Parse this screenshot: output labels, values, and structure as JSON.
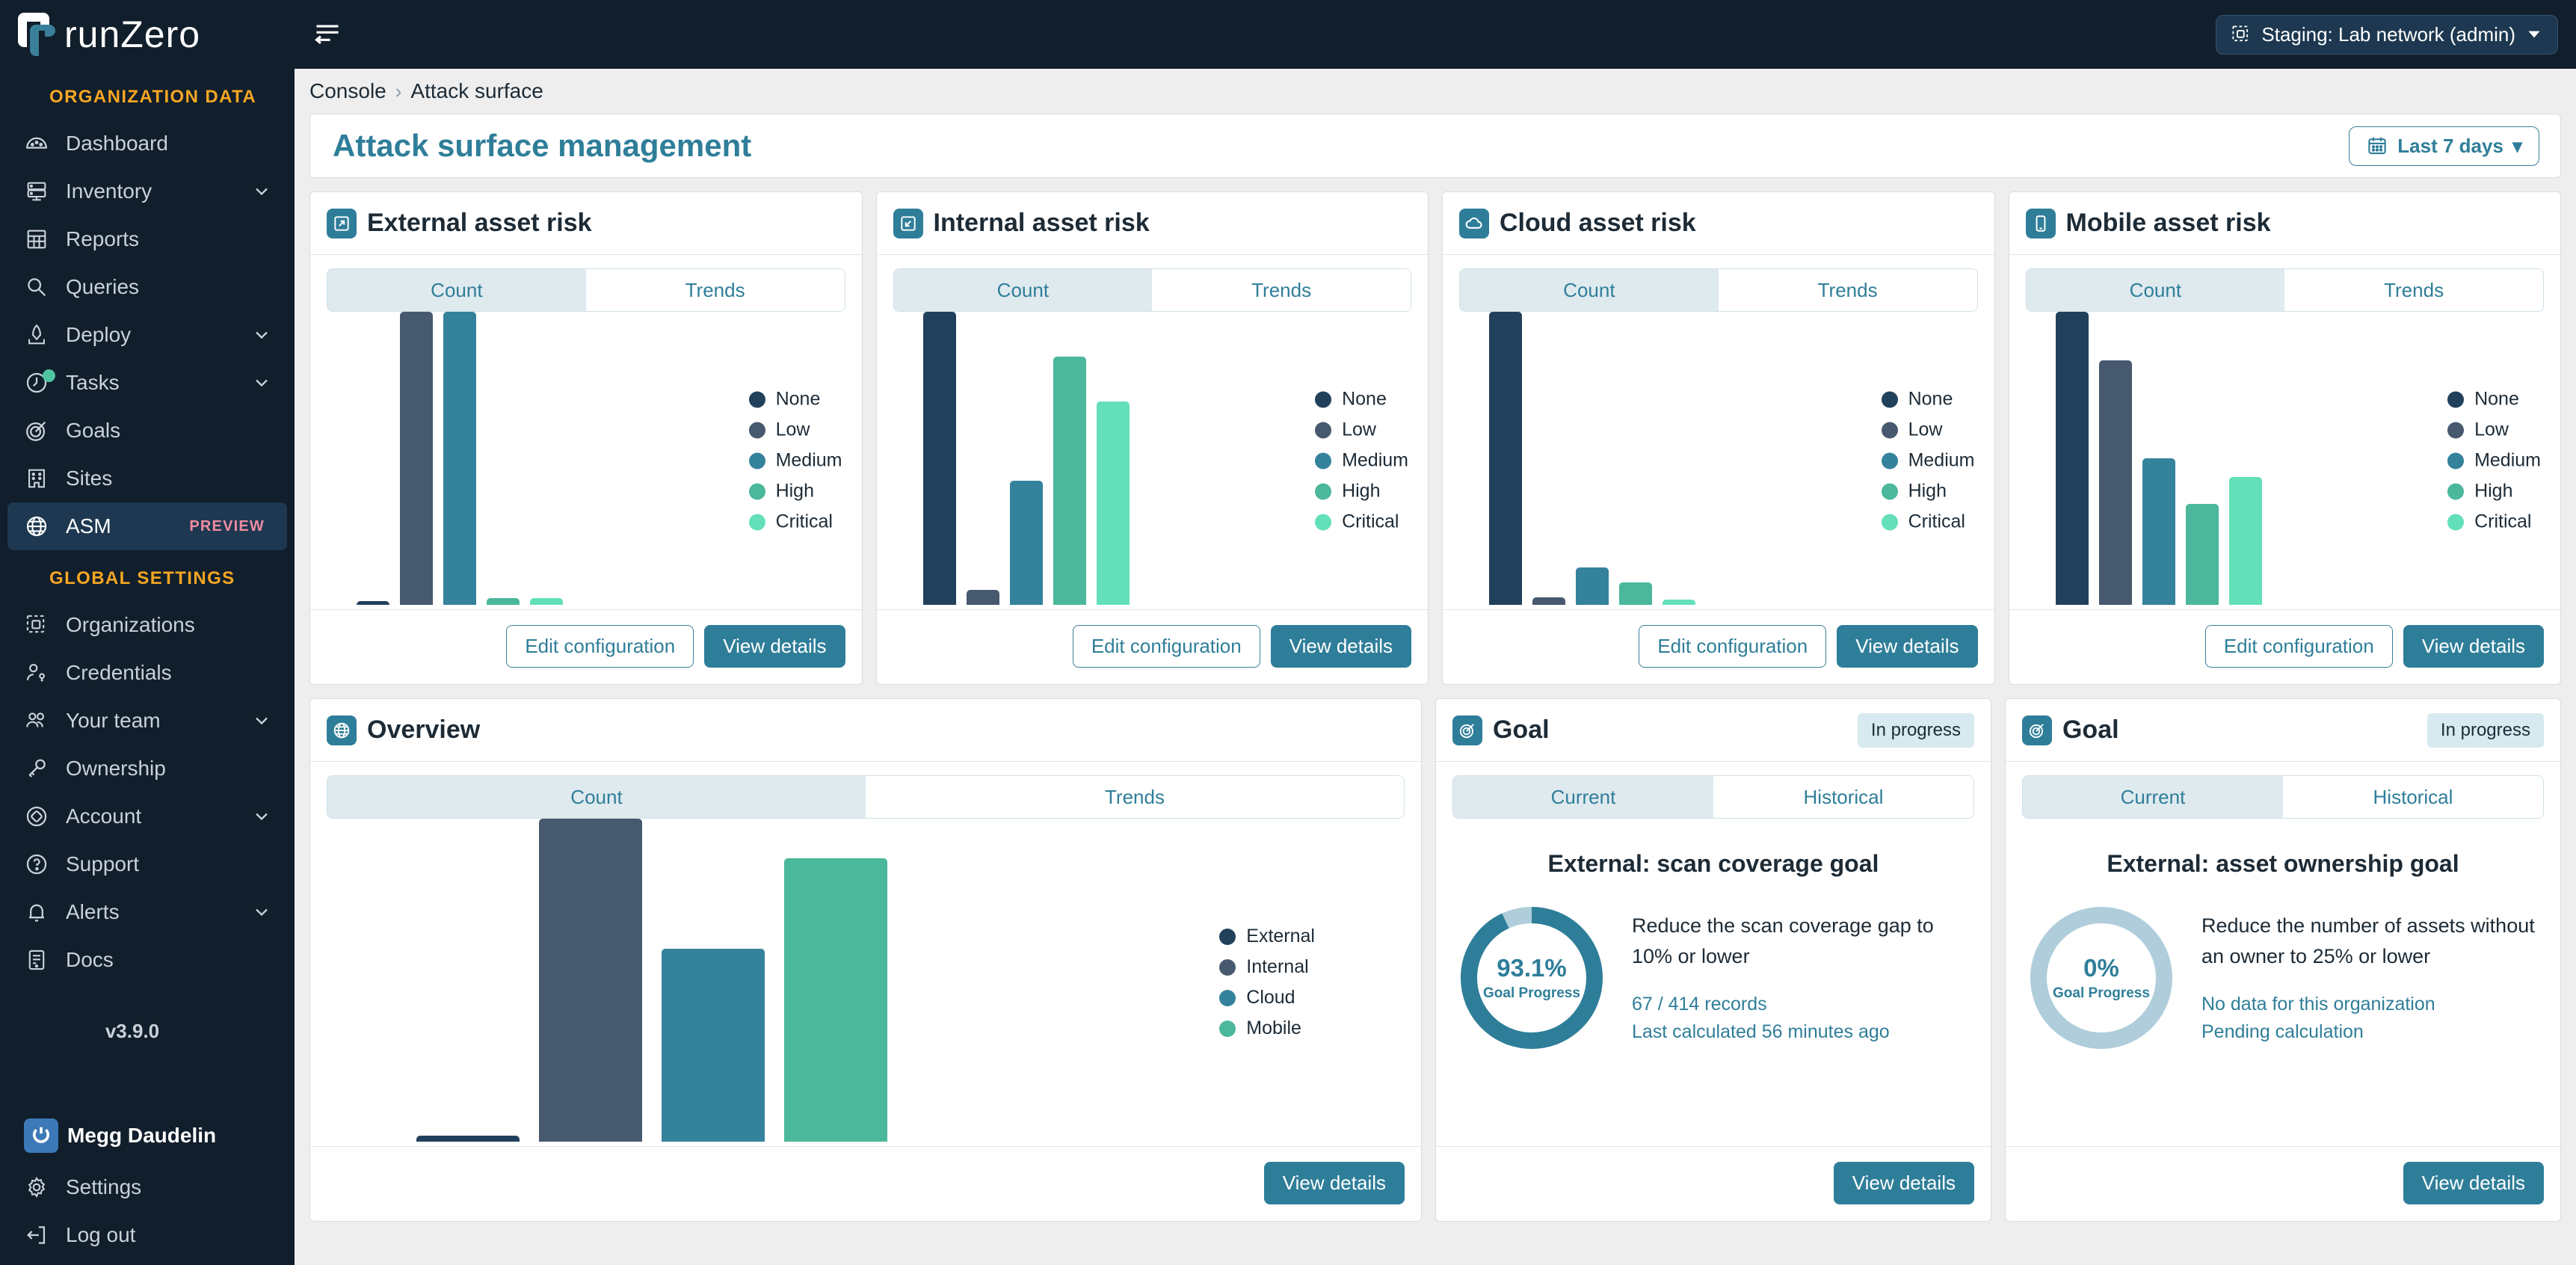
{
  "brand": {
    "name": "runZero",
    "accent": "#2f7e99",
    "sidebar_bg": "#111e2b",
    "section_color": "#f5a623"
  },
  "topbar": {
    "org_switcher": "Staging: Lab network (admin)",
    "menu_icon": "hamburger-icon"
  },
  "sidebar": {
    "section1_title": "ORGANIZATION DATA",
    "section2_title": "GLOBAL SETTINGS",
    "version": "v3.9.0",
    "user": "Megg Daudelin",
    "org_items": [
      {
        "label": "Dashboard",
        "icon": "gauge-icon",
        "expandable": false
      },
      {
        "label": "Inventory",
        "icon": "server-icon",
        "expandable": true
      },
      {
        "label": "Reports",
        "icon": "table-icon",
        "expandable": false
      },
      {
        "label": "Queries",
        "icon": "search-icon",
        "expandable": false
      },
      {
        "label": "Deploy",
        "icon": "rocket-icon",
        "expandable": true
      },
      {
        "label": "Tasks",
        "icon": "clock-icon",
        "expandable": true
      },
      {
        "label": "Goals",
        "icon": "target-icon",
        "expandable": false
      },
      {
        "label": "Sites",
        "icon": "building-icon",
        "expandable": false
      },
      {
        "label": "ASM",
        "icon": "globe-icon",
        "expandable": false,
        "badge": "PREVIEW",
        "active": true
      }
    ],
    "global_items": [
      {
        "label": "Organizations",
        "icon": "organizations-icon",
        "expandable": false
      },
      {
        "label": "Credentials",
        "icon": "credentials-icon",
        "expandable": false
      },
      {
        "label": "Your team",
        "icon": "team-icon",
        "expandable": true
      },
      {
        "label": "Ownership",
        "icon": "key-icon",
        "expandable": false
      },
      {
        "label": "Account",
        "icon": "account-icon",
        "expandable": true
      },
      {
        "label": "Support",
        "icon": "question-icon",
        "expandable": false
      },
      {
        "label": "Alerts",
        "icon": "bell-icon",
        "expandable": true
      },
      {
        "label": "Docs",
        "icon": "docs-icon",
        "expandable": false
      }
    ],
    "footer_items": [
      {
        "label": "Settings",
        "icon": "gear-icon"
      },
      {
        "label": "Log out",
        "icon": "logout-icon"
      }
    ]
  },
  "breadcrumb": {
    "root": "Console",
    "sep": "›",
    "current": "Attack surface"
  },
  "header": {
    "title": "Attack surface management",
    "date_range": "Last 7 days",
    "calendar_icon": "calendar-icon",
    "caret": "▾"
  },
  "tabs": {
    "count": "Count",
    "trends": "Trends",
    "current": "Current",
    "historical": "Historical"
  },
  "buttons": {
    "edit_configuration": "Edit configuration",
    "view_details": "View details"
  },
  "risk_colors": {
    "None": "#21405c",
    "Low": "#47596e",
    "Medium": "#34829c",
    "High": "#4bb79b",
    "Critical": "#63dfba"
  },
  "surface_colors": {
    "External": "#21405c",
    "Internal": "#47596e",
    "Cloud": "#34829c",
    "Mobile": "#4bb79b"
  },
  "cards": [
    {
      "title": "External asset risk",
      "icon": "external-link-icon",
      "active_tab": "Count"
    },
    {
      "title": "Internal asset risk",
      "icon": "internal-box-icon",
      "active_tab": "Count"
    },
    {
      "title": "Cloud asset risk",
      "icon": "cloud-icon",
      "active_tab": "Count"
    },
    {
      "title": "Mobile asset risk",
      "icon": "mobile-icon",
      "active_tab": "Count"
    }
  ],
  "overview_card": {
    "title": "Overview",
    "icon": "globe-icon",
    "active_tab": "Count"
  },
  "goals": [
    {
      "title": "Goal",
      "icon": "target-icon",
      "status": "In progress",
      "active_tab": "Current",
      "heading": "External: scan coverage goal",
      "progress_value": "93.1%",
      "progress_label": "Goal Progress",
      "progress_pct": 93.1,
      "description": "Reduce the scan coverage gap to 10% or lower",
      "meta1": "67 / 414 records",
      "meta2": "Last calculated 56 minutes ago"
    },
    {
      "title": "Goal",
      "icon": "target-icon",
      "status": "In progress",
      "active_tab": "Current",
      "heading": "External: asset ownership goal",
      "progress_value": "0%",
      "progress_label": "Goal Progress",
      "progress_pct": 0,
      "description": "Reduce the number of assets without an owner to 25% or lower",
      "meta1": "No data for this organization",
      "meta2": "Pending calculation"
    }
  ],
  "chart_data": [
    {
      "type": "bar",
      "title": "External asset risk",
      "categories": [
        "None",
        "Low",
        "Medium",
        "High",
        "Critical"
      ],
      "values": [
        1,
        92,
        92,
        2,
        2
      ],
      "legend": [
        "None",
        "Low",
        "Medium",
        "High",
        "Critical"
      ],
      "legend_position": "right",
      "grid": false,
      "xlabel": "",
      "ylabel": ""
    },
    {
      "type": "bar",
      "title": "Internal asset risk",
      "categories": [
        "None",
        "Low",
        "Medium",
        "High",
        "Critical"
      ],
      "values": [
        118,
        6,
        50,
        100,
        82
      ],
      "legend": [
        "None",
        "Low",
        "Medium",
        "High",
        "Critical"
      ],
      "legend_position": "right",
      "grid": false,
      "xlabel": "",
      "ylabel": ""
    },
    {
      "type": "bar",
      "title": "Cloud asset risk",
      "categories": [
        "None",
        "Low",
        "Medium",
        "High",
        "Critical"
      ],
      "values": [
        118,
        3,
        15,
        9,
        2
      ],
      "legend": [
        "None",
        "Low",
        "Medium",
        "High",
        "Critical"
      ],
      "legend_position": "right",
      "grid": false,
      "xlabel": "",
      "ylabel": ""
    },
    {
      "type": "bar",
      "title": "Mobile asset risk",
      "categories": [
        "None",
        "Low",
        "Medium",
        "High",
        "Critical"
      ],
      "values": [
        96,
        80,
        48,
        33,
        42
      ],
      "legend": [
        "None",
        "Low",
        "Medium",
        "High",
        "Critical"
      ],
      "legend_position": "right",
      "grid": false,
      "xlabel": "",
      "ylabel": ""
    },
    {
      "type": "bar",
      "title": "Overview",
      "categories": [
        "External",
        "Internal",
        "Cloud",
        "Mobile"
      ],
      "values": [
        2,
        114,
        68,
        100
      ],
      "legend": [
        "External",
        "Internal",
        "Cloud",
        "Mobile"
      ],
      "legend_position": "right",
      "grid": false,
      "xlabel": "",
      "ylabel": ""
    }
  ]
}
